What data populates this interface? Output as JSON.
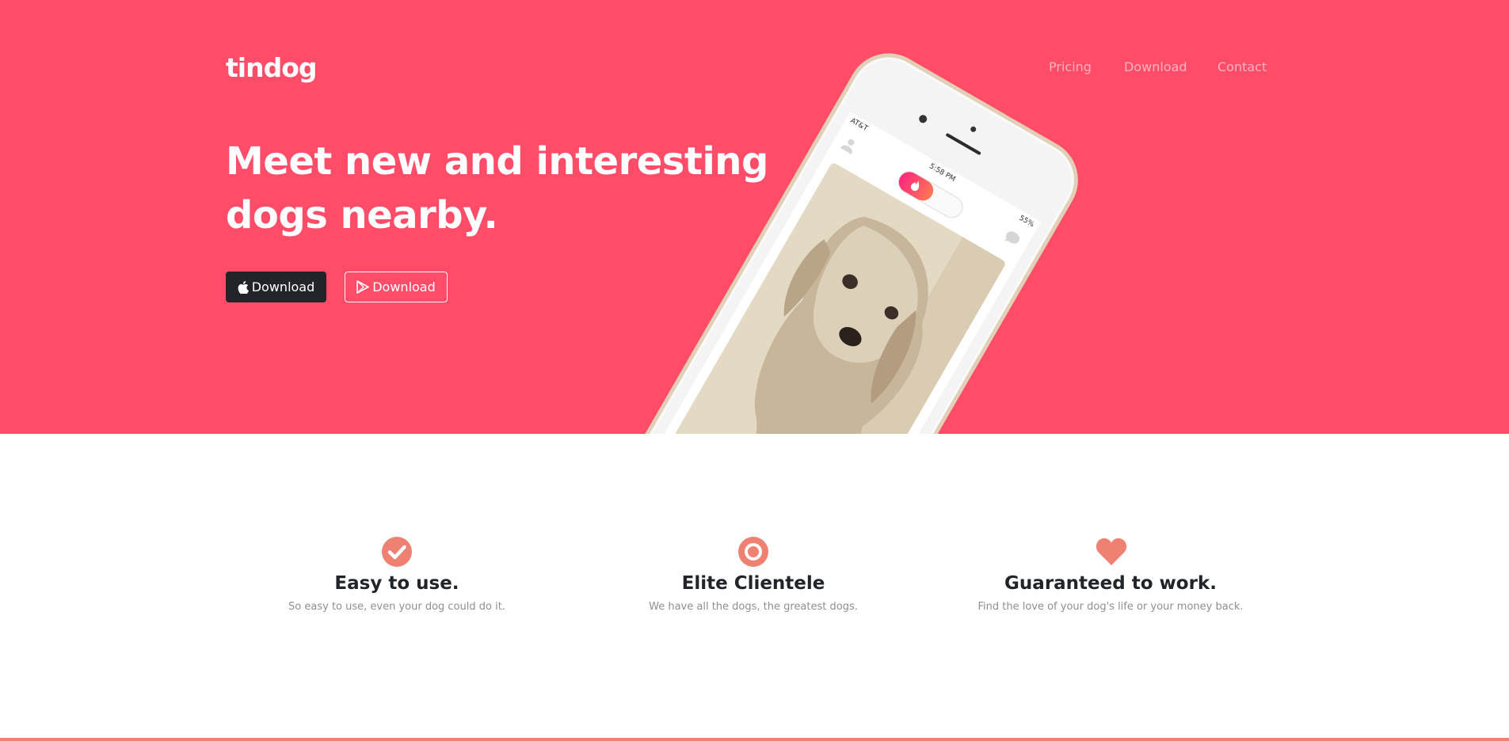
{
  "brand": {
    "name": "tindog"
  },
  "nav": {
    "items": [
      {
        "label": "Pricing"
      },
      {
        "label": "Download"
      },
      {
        "label": "Contact"
      }
    ]
  },
  "hero": {
    "headline_line1": "Meet new and interesting",
    "headline_line2": "dogs nearby.",
    "buttons": [
      {
        "label": "Download",
        "icon": "apple-icon"
      },
      {
        "label": "Download",
        "icon": "google-play-icon"
      }
    ]
  },
  "phone": {
    "carrier": "AT&T",
    "time": "5:58 PM",
    "battery": "55%"
  },
  "features": [
    {
      "icon": "check-circle-icon",
      "title": "Easy to use.",
      "text": "So easy to use, even your dog could do it."
    },
    {
      "icon": "bullseye-icon",
      "title": "Elite Clientele",
      "text": "We have all the dogs, the greatest dogs."
    },
    {
      "icon": "heart-icon",
      "title": "Guaranteed to work.",
      "text": "Find the love of your dog's life or your money back."
    }
  ],
  "colors": {
    "hero_bg": "#ff4c68",
    "accent": "#ef8172",
    "dark_button": "#212529"
  }
}
